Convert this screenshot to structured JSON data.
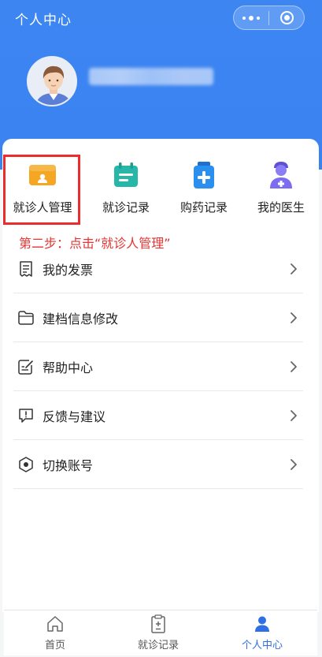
{
  "header": {
    "title": "个人中心",
    "capsule": {
      "more_icon": "more-dots-icon",
      "close_icon": "circle-close-icon"
    },
    "avatar_icon": "user-avatar"
  },
  "quick_actions": [
    {
      "label": "就诊人管理",
      "icon": "id-card-icon",
      "color": "#f5a623"
    },
    {
      "label": "就诊记录",
      "icon": "calendar-record-icon",
      "color": "#26b7a8"
    },
    {
      "label": "购药记录",
      "icon": "medicine-bottle-icon",
      "color": "#2b8ff0"
    },
    {
      "label": "我的医生",
      "icon": "doctor-icon",
      "color": "#7c6cf2"
    }
  ],
  "instruction": "第二步：点击“就诊人管理”",
  "highlight_color": "#ee2b2b",
  "menu": [
    {
      "label": "我的发票",
      "icon": "invoice-icon"
    },
    {
      "label": "建档信息修改",
      "icon": "folder-icon"
    },
    {
      "label": "帮助中心",
      "icon": "edit-note-icon"
    },
    {
      "label": "反馈与建议",
      "icon": "feedback-icon"
    },
    {
      "label": "切换账号",
      "icon": "hexagon-switch-icon"
    }
  ],
  "tabbar": [
    {
      "label": "首页",
      "icon": "home-icon",
      "active": false
    },
    {
      "label": "就诊记录",
      "icon": "clipboard-icon",
      "active": false
    },
    {
      "label": "个人中心",
      "icon": "person-icon",
      "active": true
    }
  ],
  "colors": {
    "header_blue": "#3a82f0",
    "active_tab": "#2e6fe6",
    "instruction_red": "#e63232"
  }
}
